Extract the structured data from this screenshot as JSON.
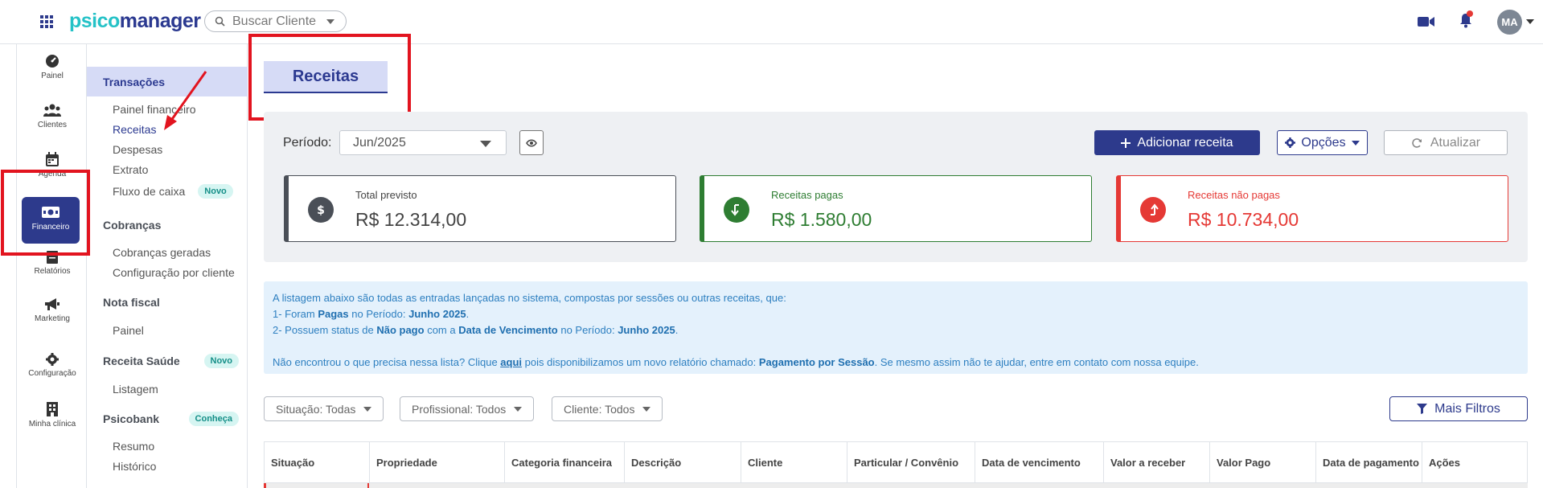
{
  "brand": {
    "name_part1": "psico",
    "name_part2": "manager"
  },
  "search": {
    "placeholder": "Buscar Cliente"
  },
  "user": {
    "initials": "MA"
  },
  "leftnav": [
    {
      "label": "Painel",
      "icon": "gauge-icon"
    },
    {
      "label": "Clientes",
      "icon": "users-icon"
    },
    {
      "label": "Agenda",
      "icon": "calendar-icon"
    },
    {
      "label": "Financeiro",
      "icon": "money-icon",
      "active": true
    },
    {
      "label": "Relatórios",
      "icon": "report-icon"
    },
    {
      "label": "Marketing",
      "icon": "megaphone-icon"
    },
    {
      "label": "Configuração",
      "icon": "gear-icon"
    },
    {
      "label": "Minha clínica",
      "icon": "building-icon"
    }
  ],
  "subnav": {
    "transacoes": {
      "title": "Transações",
      "items": [
        "Painel financeiro",
        "Receitas",
        "Despesas",
        "Extrato",
        "Fluxo de caixa"
      ],
      "badge": "Novo"
    },
    "cobrancas": {
      "title": "Cobranças",
      "items": [
        "Cobranças geradas",
        "Configuração por cliente"
      ]
    },
    "nota_fiscal": {
      "title": "Nota fiscal",
      "items": [
        "Painel"
      ]
    },
    "receita_saude": {
      "title": "Receita Saúde",
      "badge": "Novo",
      "items": [
        "Listagem"
      ]
    },
    "psicobank": {
      "title": "Psicobank",
      "badge": "Conheça",
      "items": [
        "Resumo",
        "Histórico"
      ]
    }
  },
  "page": {
    "title": "Receitas"
  },
  "filters": {
    "periodo_label": "Período:",
    "periodo_value": "Jun/2025",
    "add_button": "Adicionar receita",
    "options_button": "Opções",
    "refresh_button": "Atualizar"
  },
  "cards": [
    {
      "label": "Total previsto",
      "value": "R$ 12.314,00",
      "icon": "dollar-icon"
    },
    {
      "label": "Receitas pagas",
      "value": "R$ 1.580,00",
      "icon": "arrow-down-icon"
    },
    {
      "label": "Receitas não pagas",
      "value": "R$ 10.734,00",
      "icon": "arrow-up-icon"
    }
  ],
  "info": {
    "line1": "A listagem abaixo são todas as entradas lançadas no sistema, compostas por sessões ou outras receitas, que:",
    "l2a": "1- Foram ",
    "l2b": "Pagas",
    "l2c": " no Período: ",
    "l2d": "Junho 2025",
    "l2e": ".",
    "l3a": "2- Possuem status de ",
    "l3b": "Não pago",
    "l3c": " com a ",
    "l3d": "Data de Vencimento",
    "l3e": " no Período: ",
    "l3f": "Junho 2025",
    "l3g": ".",
    "l4a": "Não encontrou o que precisa nessa lista? Clique ",
    "l4b": "aqui",
    "l4c": " pois disponibilizamos um novo relatório chamado: ",
    "l4d": "Pagamento por Sessão",
    "l4e": ". Se mesmo assim não te ajudar, entre em contato com nossa equipe."
  },
  "chips": [
    "Situação: Todas",
    "Profissional: Todos",
    "Cliente: Todos"
  ],
  "more_filters": "Mais Filtros",
  "table": {
    "columns": [
      "Situação",
      "Propriedade",
      "Categoria financeira",
      "Descrição",
      "Cliente",
      "Particular / Convênio",
      "Data de vencimento",
      "Valor a receber",
      "Valor Pago",
      "Data de pagamento",
      "Ações"
    ]
  },
  "colors": {
    "primary": "#2d3a8c",
    "accent": "#25c2c7",
    "success": "#2e7d32",
    "danger": "#e53935",
    "annotation": "#e2141f"
  }
}
